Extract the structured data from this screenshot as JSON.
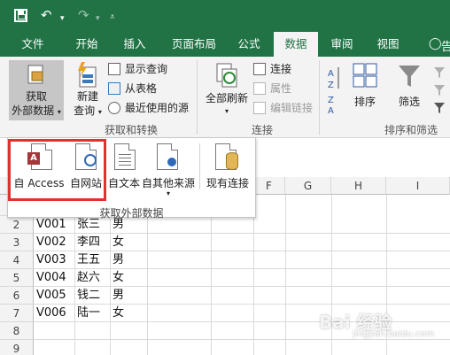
{
  "quick_access": {
    "save_icon": "save-icon",
    "undo_icon": "↶",
    "redo_icon": "↷",
    "dropdown_glyph": "▾",
    "customize_glyph": "⩡"
  },
  "tabs": [
    {
      "label": "文件",
      "active": false
    },
    {
      "label": "开始",
      "active": false
    },
    {
      "label": "插入",
      "active": false
    },
    {
      "label": "页面布局",
      "active": false
    },
    {
      "label": "公式",
      "active": false
    },
    {
      "label": "数据",
      "active": true
    },
    {
      "label": "审阅",
      "active": false
    },
    {
      "label": "视图",
      "active": false
    }
  ],
  "tell_me": {
    "icon": "lightbulb-icon",
    "text": "告"
  },
  "ribbon": {
    "get_external": {
      "line1": "获取",
      "line2": "外部数据",
      "arrow": "▾"
    },
    "new_query": {
      "line1": "新建",
      "line2": "查询",
      "arrow": "▾"
    },
    "show_queries": "显示查询",
    "from_table": "从表格",
    "recent_sources": "最近使用的源",
    "group_get_transform": "获取和转换",
    "refresh_all": {
      "line1": "全部刷新",
      "arrow": "▾"
    },
    "connections": "连接",
    "properties": "属性",
    "edit_links": "编辑链接",
    "group_connections": "连接",
    "sort_az": "A Z",
    "sort_label": "排序",
    "filter_label": "筛选",
    "group_sort_filter": "排序和筛选"
  },
  "dropdown": {
    "items": [
      {
        "label": "自 Access"
      },
      {
        "label": "自网站"
      },
      {
        "label": "自文本"
      },
      {
        "label": "自其他来源",
        "arrow": "▾"
      },
      {
        "label": "现有连接"
      }
    ],
    "caption": "获取外部数据",
    "access_badge": "A"
  },
  "grid": {
    "columns": [
      "F",
      "G",
      "H",
      "I"
    ],
    "rows": [
      {
        "num": "2",
        "a": "V001",
        "b": "张三",
        "c": "男"
      },
      {
        "num": "3",
        "a": "V002",
        "b": "李四",
        "c": "女"
      },
      {
        "num": "4",
        "a": "V003",
        "b": "王五",
        "c": "男"
      },
      {
        "num": "5",
        "a": "V004",
        "b": "赵六",
        "c": "女"
      },
      {
        "num": "6",
        "a": "V005",
        "b": "钱二",
        "c": "男"
      },
      {
        "num": "7",
        "a": "V006",
        "b": "陆一",
        "c": "女"
      },
      {
        "num": "8",
        "a": "",
        "b": "",
        "c": ""
      },
      {
        "num": "9",
        "a": "",
        "b": "",
        "c": ""
      }
    ]
  },
  "watermark": {
    "text": "Bai 经验",
    "sub": "jingyan.baidu.com"
  },
  "colors": {
    "excel_green": "#217346",
    "highlight_red": "#e23030"
  }
}
